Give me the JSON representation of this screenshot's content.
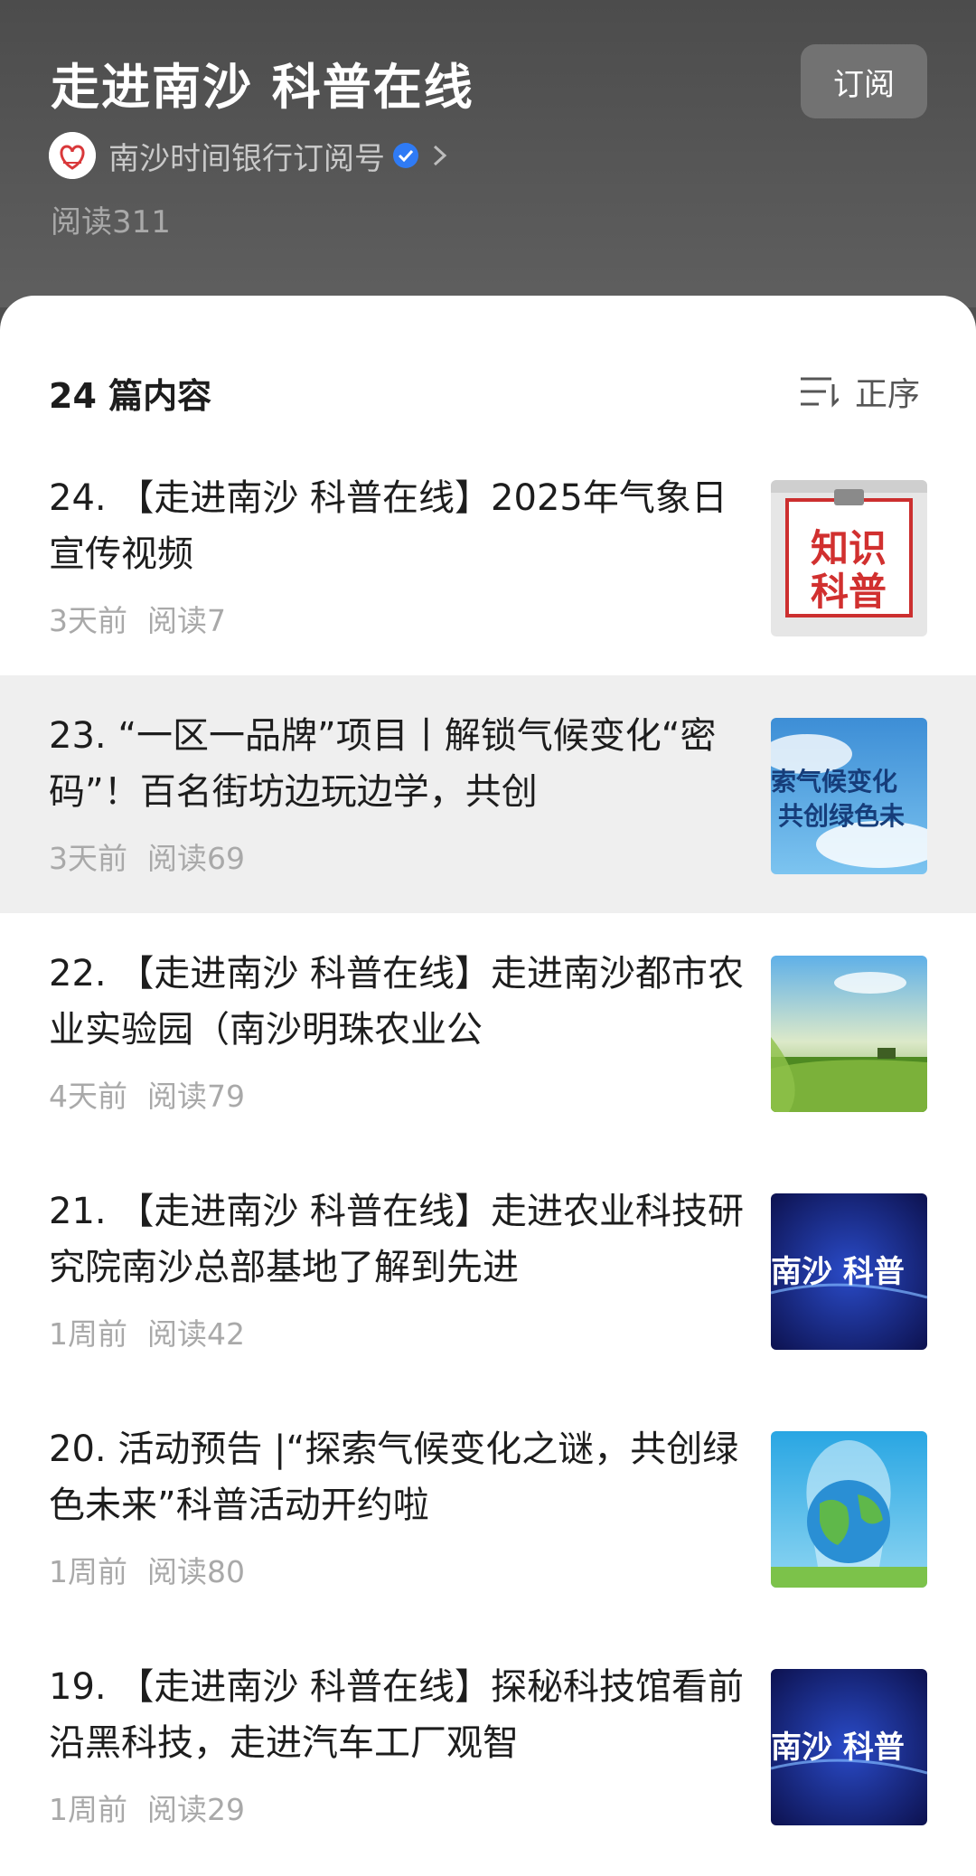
{
  "header": {
    "title": "走进南沙 科普在线",
    "subscribe_label": "订阅",
    "account_name": "南沙时间银行订阅号",
    "reads": "阅读311"
  },
  "list": {
    "count_label": "24 篇内容",
    "sort_label": "正序",
    "items": [
      {
        "title": "24. 【走进南沙 科普在线】2025年气象日宣传视频",
        "time": "3天前",
        "reads": "阅读7",
        "thumb_text": "知识科普"
      },
      {
        "title": "23. “一区一品牌”项目丨解锁气候变化“密码”！百名街坊边玩边学，共创",
        "time": "3天前",
        "reads": "阅读69",
        "thumb_text": "索气候变化 共创绿色未"
      },
      {
        "title": "22. 【走进南沙 科普在线】走进南沙都市农业实验园（南沙明珠农业公",
        "time": "4天前",
        "reads": "阅读79"
      },
      {
        "title": "21. 【走进南沙 科普在线】走进农业科技研究院南沙总部基地了解到先进",
        "time": "1周前",
        "reads": "阅读42",
        "thumb_text": "南沙 科普"
      },
      {
        "title": "20. 活动预告 |“探索气候变化之谜，共创绿色未来”科普活动开约啦",
        "time": "1周前",
        "reads": "阅读80"
      },
      {
        "title": "19. 【走进南沙 科普在线】探秘科技馆看前沿黑科技，走进汽车工厂观智",
        "time": "1周前",
        "reads": "阅读29",
        "thumb_text": "南沙 科普"
      }
    ]
  },
  "colors": {
    "header_bg": "#555555",
    "highlight_row": "#efefef",
    "verified_blue": "#2f7bf5"
  }
}
